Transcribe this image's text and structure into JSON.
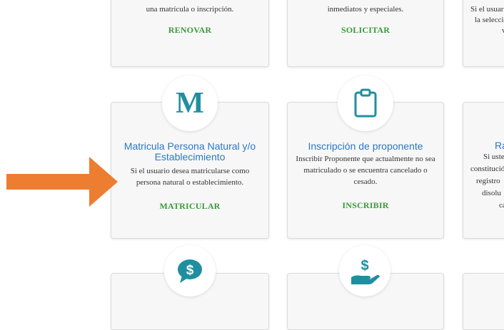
{
  "top_row": [
    {
      "desc": "una matrícula o inscripción.",
      "action": "RENOVAR"
    },
    {
      "desc": "inmediatos y especiales.",
      "action": "SOLICITAR"
    },
    {
      "desc_lines": [
        "Si el usuari",
        "la selecció",
        "ver"
      ]
    }
  ],
  "middle_row": [
    {
      "icon": "letter-m-icon",
      "icon_text": "M",
      "title": "Matricula Persona Natural y/o Establecimiento",
      "desc": "Si el usuario desea matricularse como persona natural o establecimiento.",
      "action": "MATRICULAR"
    },
    {
      "icon": "clipboard-icon",
      "title": "Inscripción de proponente",
      "desc": "Inscribir Proponente que actualmente no sea matriculado o se encuentra cancelado o cesado.",
      "action": "INSCRIBIR"
    },
    {
      "title": "Ra",
      "desc_lines": [
        "Si usted",
        "constitució",
        "registro",
        "disolu",
        "ca"
      ]
    }
  ],
  "bottom_row": [
    {
      "icon": "money-speech-bubble-icon"
    },
    {
      "icon": "dollar-hand-icon"
    }
  ],
  "pointer": {
    "icon": "arrow-right-icon",
    "color": "#ed7d31"
  },
  "colors": {
    "accent_teal": "#1f8fa0",
    "title_blue": "#2a78c5",
    "action_green": "#3a9a3a"
  }
}
